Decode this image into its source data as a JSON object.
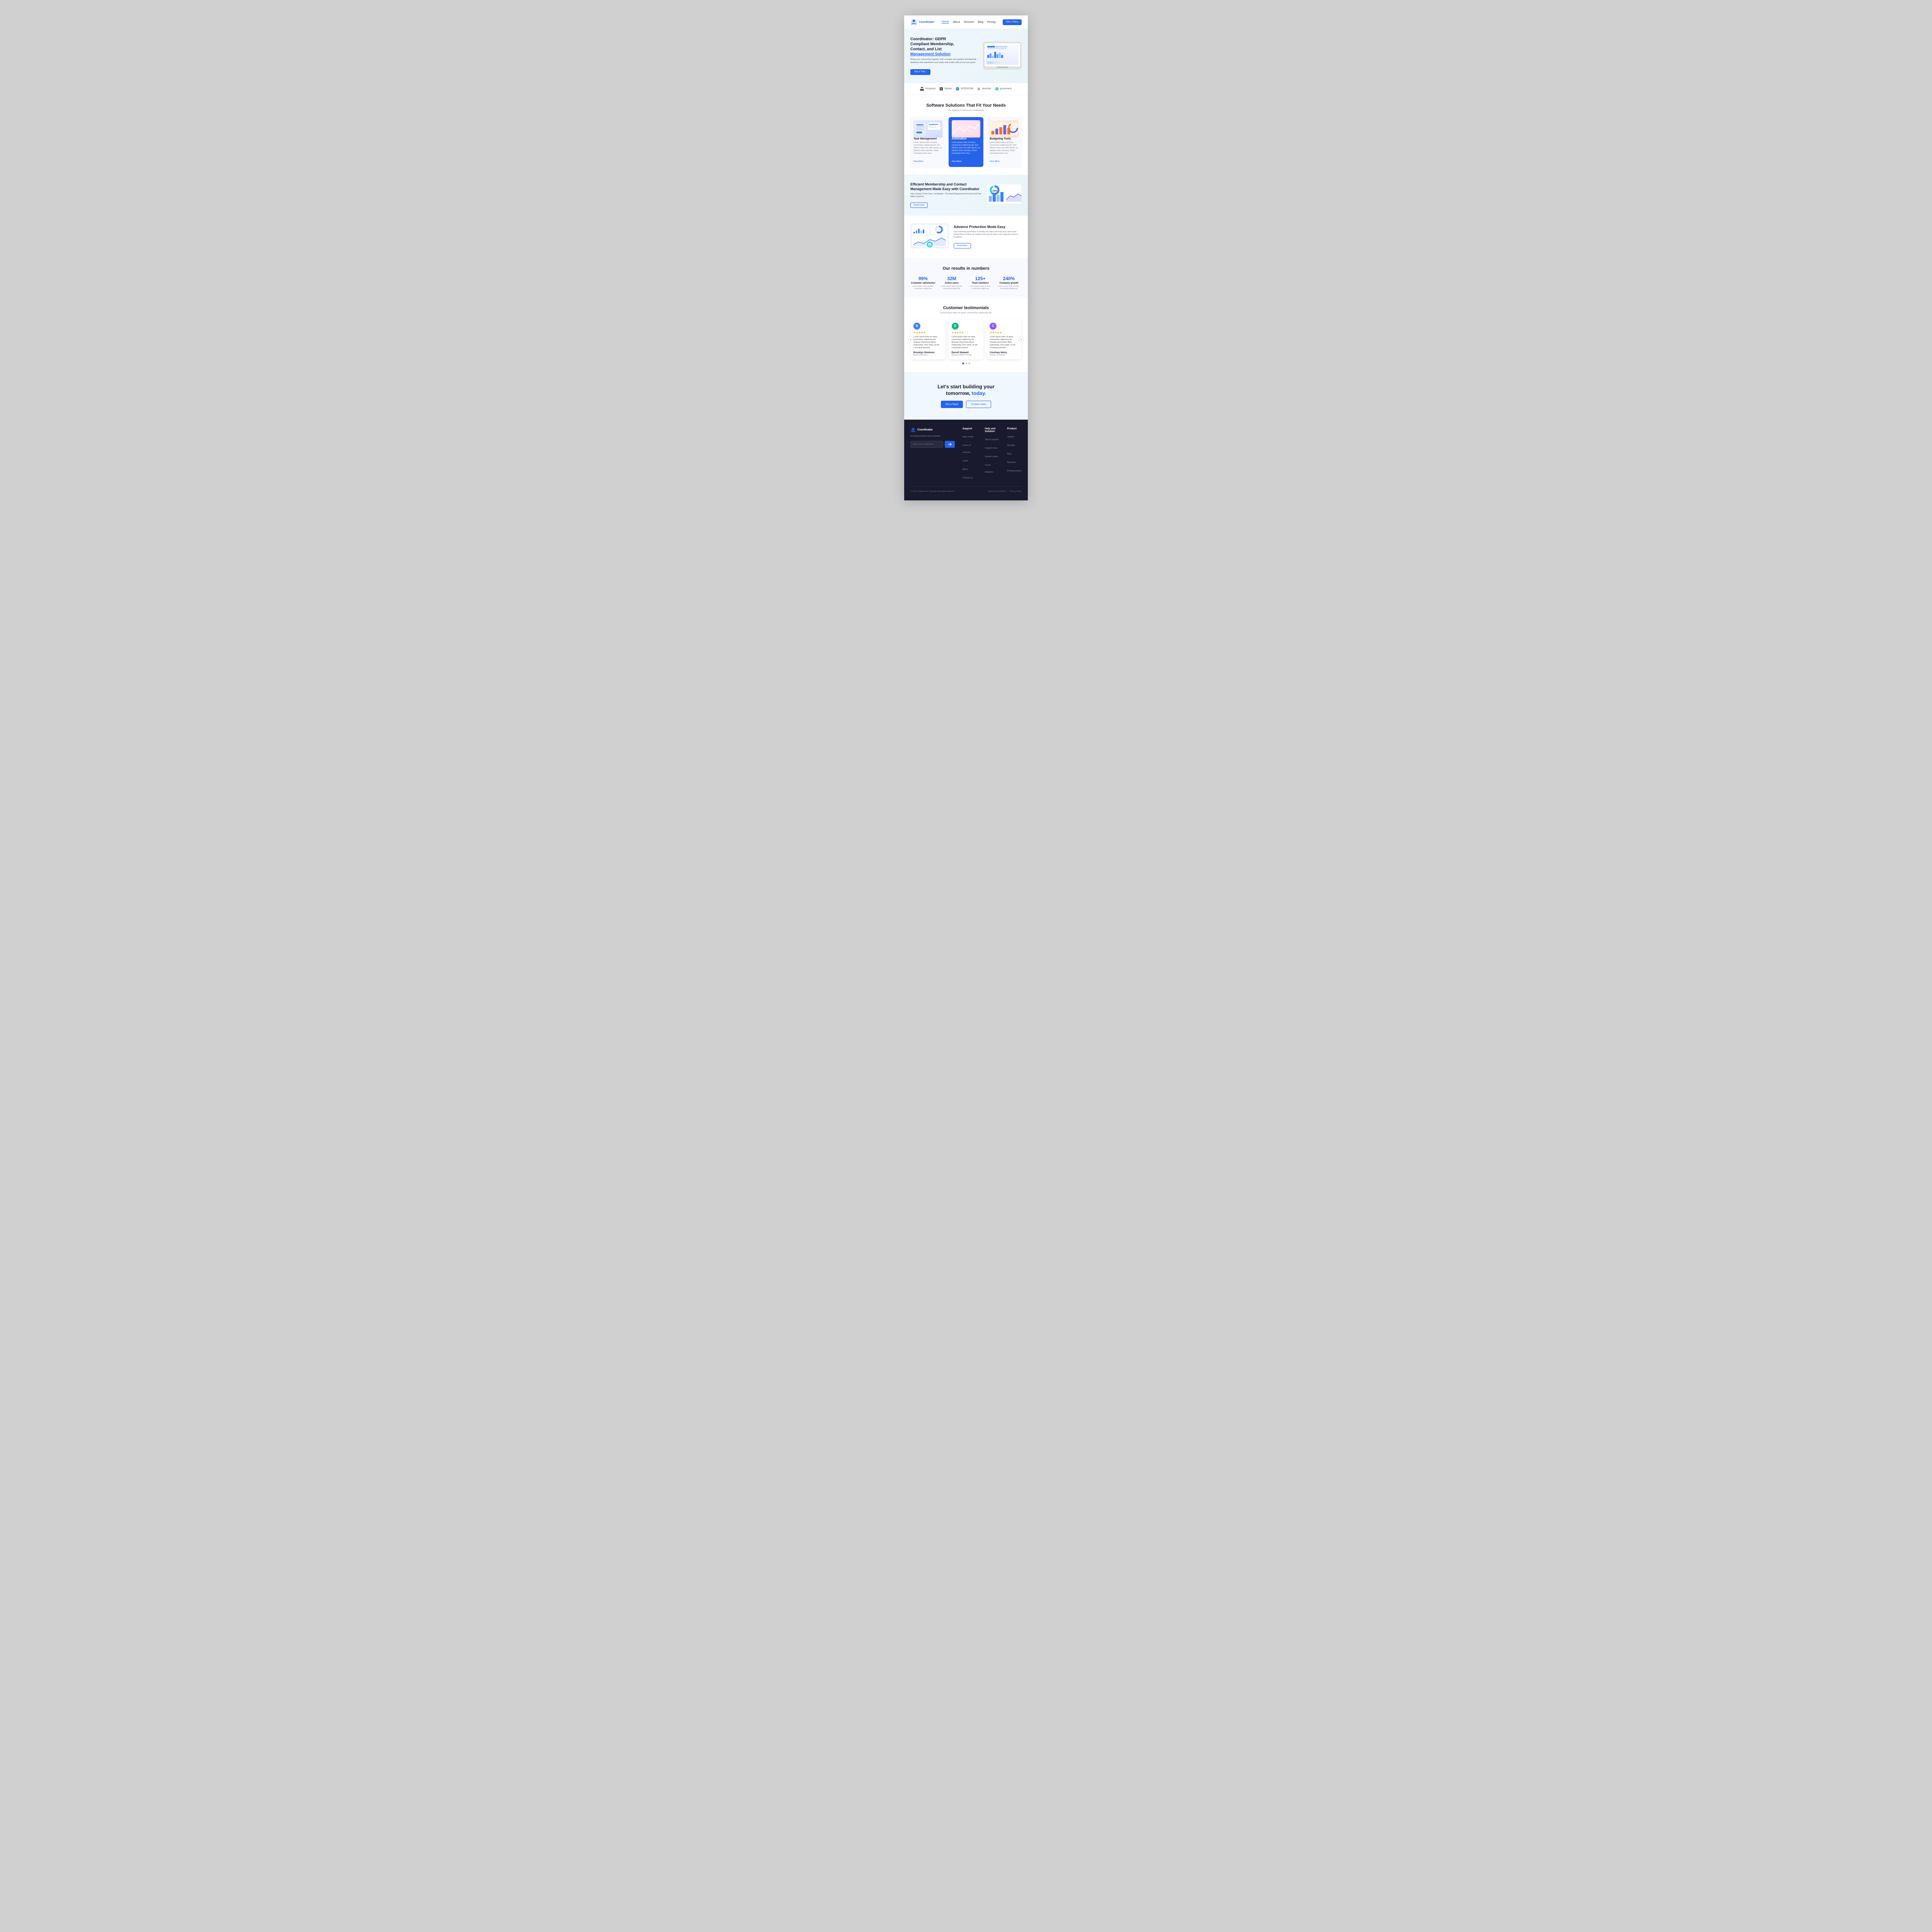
{
  "nav": {
    "logo_text": "Coordinator",
    "links": [
      "Home",
      "About",
      "Services",
      "Blog",
      "Pricing"
    ],
    "cta_label": "Get a Trial"
  },
  "hero": {
    "title_line1": "Coordinator: GDPR",
    "title_line2": "Compliant Membership,",
    "title_line3": "Contact, and List",
    "title_underline": "Management Solution",
    "description": "Bring your community together with a simple and intuitive membership database that automates your tasks and scales with you as you grow.",
    "cta_label": "Get a Trial"
  },
  "logos": {
    "items": [
      "Unsplash",
      "Notion",
      "INTERCOM",
      "descript",
      "grammarly"
    ]
  },
  "solutions": {
    "title": "Software Solutions That Fit Your Needs",
    "subtitle": "The features to boost your productivity.",
    "cards": [
      {
        "title": "Task Management",
        "description": "Lorem ipsum dolor sit amet, consectetur adipiscing elit. Sed efficitur tortor non nibh dictum, at dapibus dolor faucibus. Etiam consequat tortor arcu.",
        "link": "View More",
        "active": false
      },
      {
        "title": "Automation",
        "description": "Lorem ipsum dolor sit amet, consectetur adipiscing elit. Sed efficitur tortor non nibh dictum, at dapibus dolor faucibus. Etiam consequat tortor arcu.",
        "link": "View More",
        "active": true
      },
      {
        "title": "Budgeting Tools",
        "description": "Lorem ipsum dolor sit amet, consectetur adipiscing elit. Sed efficitur tortor non nibh dictum, at dapibus dolor faucibus. Etiam consequat tortor arcu.",
        "link": "View More",
        "active": false
      }
    ]
  },
  "membership": {
    "title": "Efficient Membership and Contact Management Made Easy with Coordinator",
    "subtitle": "Take Control of Your Data: Coordinator - The Ideal Replacement for Excel and Your Native Systems.",
    "btn_label": "Read more"
  },
  "advance": {
    "title": "Advance Protection Mode Easy",
    "description": "Use marketing automation to identify hot leads and email your sales team letting them to follow up. Nurture and convert leads at the opportune time to maximize.",
    "btn_label": "Read More"
  },
  "numbers": {
    "title": "Our results in numbers",
    "items": [
      {
        "value": "99%",
        "label": "Customer satisfaction",
        "desc": "Lorem ipsum dolor sit amet, consectetur adipiscing."
      },
      {
        "value": "32M",
        "label": "Active users",
        "desc": "Lorem ipsum dolor sit amet, consectetur adipiscing."
      },
      {
        "value": "125+",
        "label": "Team members",
        "desc": "Lorem ipsum dolor sit amet, consectetur adipiscing."
      },
      {
        "value": "240%",
        "label": "Company growth",
        "desc": "Lorem ipsum dolor sit amet, consectetur adipiscing."
      }
    ]
  },
  "testimonials": {
    "title": "Customer testimonials",
    "subtitle": "Lorem ipsum dolor sit amet, consectetur adipiscing elit.",
    "items": [
      {
        "stars": "★★★★★",
        "text": "Lorem ipsum dolor sit amet, consectetur adipiscing elit. Quisque elementum libero malesuada, Duis variat, sit elit consequat posuere.",
        "author": "Brooklyn Simmons",
        "role": "Bank of America",
        "avatar_color": "#3b82f6"
      },
      {
        "stars": "★★★★★",
        "text": "Lorem ipsum dolor sit amet, consectetur adipiscing elit. Quisque elementum libero malesuada, Duis variat, sit elit consequat posuere.",
        "author": "Darrell Steward",
        "role": "Amazon Athletic Group",
        "avatar_color": "#10b981"
      },
      {
        "stars": "★★★★★",
        "text": "Lorem ipsum dolor sit amet, consectetur adipiscing elit. Quisque elementum libero malesuada, Duis variat, sit elit consequat posuere.",
        "author": "Courtney Henry",
        "role": "Unicorn & Unicorn",
        "avatar_color": "#8b5cf6"
      }
    ]
  },
  "cta": {
    "title_line1": "Let's start building your",
    "title_line2": "tomorrow, ",
    "title_highlight": "today.",
    "btn_primary": "Get a Team",
    "btn_secondary": "Contact sales"
  },
  "footer": {
    "brand_name": "Coordinator",
    "brand_desc": "Get started today to try our product.",
    "email_placeholder": "Enter your email here",
    "cols": [
      {
        "title": "Support",
        "links": [
          "Help center",
          "Terms of services",
          "Legal",
          "About",
          "Contact us"
        ]
      },
      {
        "title": "Help and Solution",
        "links": [
          "Talk to support",
          "Support docs",
          "System status",
          "Covid response"
        ]
      },
      {
        "title": "Product",
        "links": [
          "Update",
          "Security",
          "Beta",
          "Beta test",
          "Pricing product"
        ]
      }
    ],
    "copyright": "© 2022 contigo.com. Copyright and rights reserved",
    "legal_links": [
      "Terms and Conditions",
      "Privacy Policy"
    ]
  }
}
